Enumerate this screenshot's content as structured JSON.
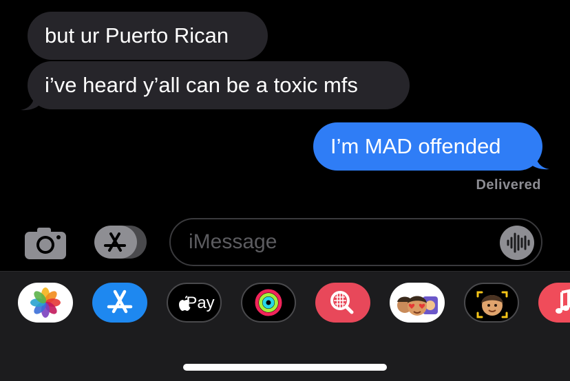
{
  "conversation": {
    "messages": [
      {
        "direction": "received",
        "text": "but ur Puerto Rican"
      },
      {
        "direction": "received",
        "text": "i’ve heard y’all can be a toxic mfs"
      },
      {
        "direction": "sent",
        "text": "I’m MAD offended"
      }
    ],
    "status": "Delivered"
  },
  "composer": {
    "placeholder": "iMessage",
    "left_icons": [
      "camera-icon",
      "app-store-icon"
    ],
    "right_icon": "audio-waveform-icon"
  },
  "app_drawer": {
    "apps": [
      {
        "name": "Photos",
        "icon": "photos-icon"
      },
      {
        "name": "App Store",
        "icon": "app-store-icon"
      },
      {
        "name": "Apple Pay",
        "icon": "apple-pay-icon",
        "label": "Pay"
      },
      {
        "name": "Activity",
        "icon": "activity-rings-icon"
      },
      {
        "name": "Images",
        "icon": "image-search-icon"
      },
      {
        "name": "Memoji Stickers",
        "icon": "memoji-stickers-icon"
      },
      {
        "name": "Memoji",
        "icon": "memoji-icon"
      },
      {
        "name": "Music",
        "icon": "music-note-icon"
      }
    ]
  },
  "colors": {
    "background": "#000000",
    "received_bubble": "#26252a",
    "sent_bubble": "#2f7df6",
    "drawer": "#1c1c1e"
  }
}
